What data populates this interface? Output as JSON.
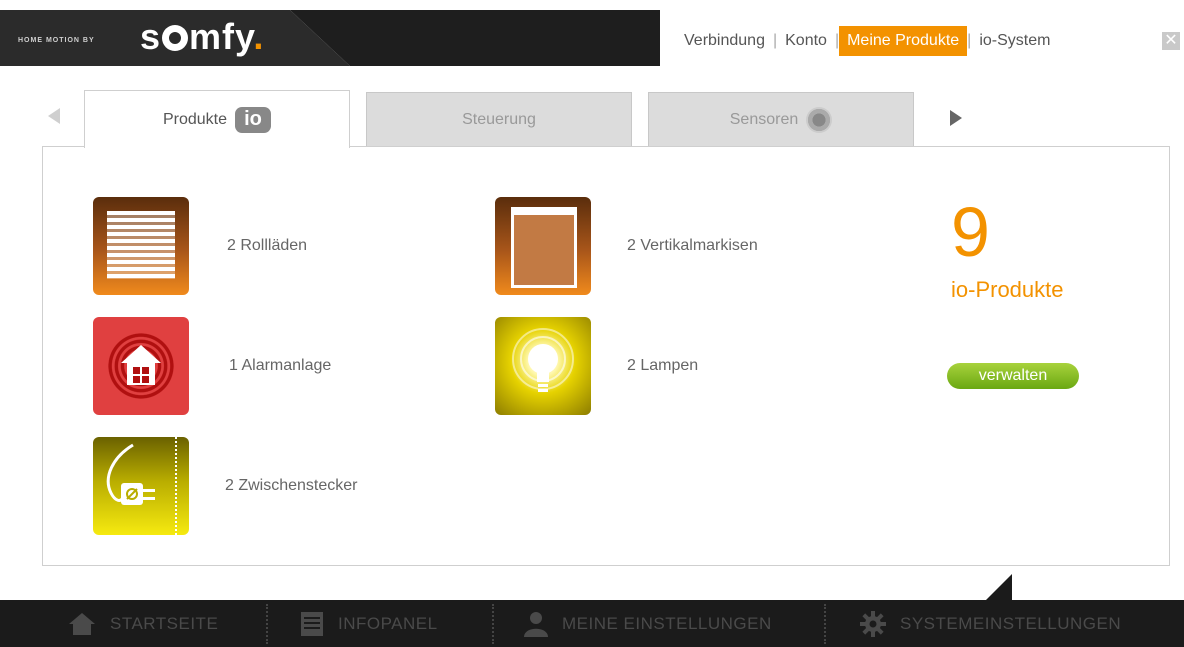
{
  "brand": {
    "small": "HOME MOTION BY",
    "name_pre": "s",
    "name_post": "mfy",
    "name_dot": "."
  },
  "top_nav": {
    "items": [
      "Verbindung",
      "Konto",
      "Meine Produkte",
      "io-System"
    ],
    "active": "Meine Produkte"
  },
  "tabs": [
    {
      "label": "Produkte",
      "badge": "io"
    },
    {
      "label": "Steuerung"
    },
    {
      "label": "Sensoren"
    }
  ],
  "products": [
    {
      "label": "2 Rollläden",
      "icon": "roller-shutter-icon"
    },
    {
      "label": "2 Vertikalmarkisen",
      "icon": "vertical-awning-icon"
    },
    {
      "label": "1 Alarmanlage",
      "icon": "alarm-house-icon"
    },
    {
      "label": "2 Lampen",
      "icon": "lamp-icon"
    },
    {
      "label": "2 Zwischenstecker",
      "icon": "plug-icon"
    }
  ],
  "summary": {
    "count": "9",
    "label": "io-Produkte",
    "manage_label": "verwalten"
  },
  "bottom_nav": [
    "STARTSEITE",
    "INFOPANEL",
    "MEINE EINSTELLUNGEN",
    "SYSTEMEINSTELLUNGEN"
  ],
  "colors": {
    "accent": "#f39200",
    "green": "#7cb81a",
    "dark": "#1b1b1b"
  }
}
